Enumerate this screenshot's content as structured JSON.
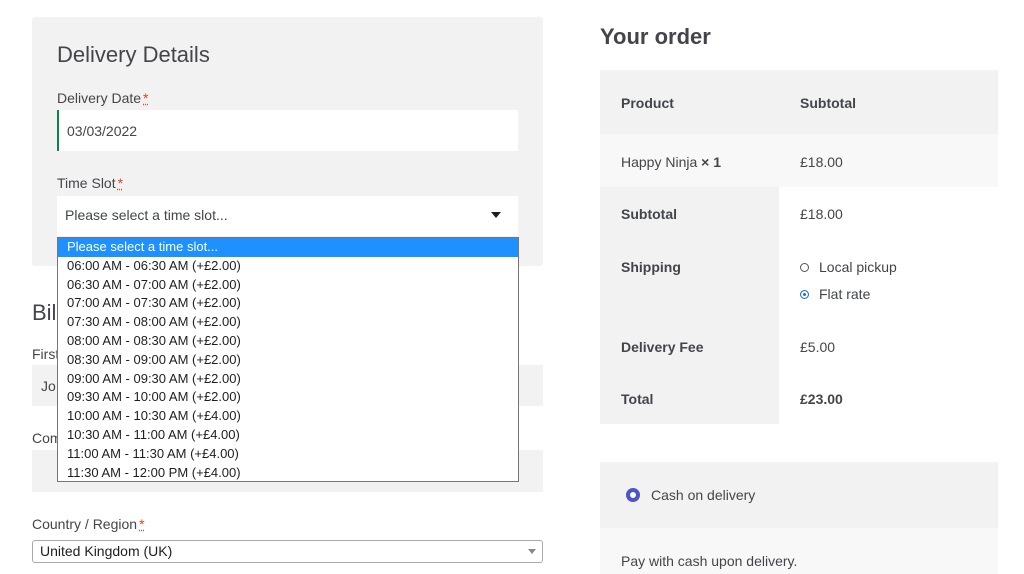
{
  "delivery": {
    "title": "Delivery Details",
    "date_label": "Delivery Date",
    "required_mark": "*",
    "date_value": "03/03/2022",
    "time_slot_label": "Time Slot",
    "time_slot_selected": "Please select a time slot...",
    "time_slot_options": [
      "Please select a time slot...",
      "06:00 AM - 06:30 AM (+£2.00)",
      "06:30 AM - 07:00 AM (+£2.00)",
      "07:00 AM - 07:30 AM (+£2.00)",
      "07:30 AM - 08:00 AM (+£2.00)",
      "08:00 AM - 08:30 AM (+£2.00)",
      "08:30 AM - 09:00 AM (+£2.00)",
      "09:00 AM - 09:30 AM (+£2.00)",
      "09:30 AM - 10:00 AM (+£2.00)",
      "10:00 AM - 10:30 AM (+£4.00)",
      "10:30 AM - 11:00 AM (+£4.00)",
      "11:00 AM - 11:30 AM (+£4.00)",
      "11:30 AM - 12:00 PM (+£4.00)"
    ]
  },
  "billing": {
    "title_partial": "Bil",
    "first_name_label_partial": "First",
    "first_name_value_partial": "Jo",
    "company_label_partial": "Com",
    "country_label": "Country / Region",
    "country_value": "United Kingdom (UK)"
  },
  "order": {
    "title": "Your order",
    "header_product": "Product",
    "header_subtotal": "Subtotal",
    "item_name": "Happy Ninja",
    "item_qty": "× 1",
    "item_price": "£18.00",
    "subtotal_label": "Subtotal",
    "subtotal_value": "£18.00",
    "shipping_label": "Shipping",
    "shipping_option_1": "Local pickup",
    "shipping_option_2": "Flat rate",
    "delivery_fee_label": "Delivery Fee",
    "delivery_fee_value": "£5.00",
    "total_label": "Total",
    "total_value": "£23.00"
  },
  "payment": {
    "method": "Cash on delivery",
    "description": "Pay with cash upon delivery."
  },
  "colors": {
    "accent_green": "#0f834d",
    "required_red": "#e2401c",
    "highlight_blue": "#1e90ff",
    "radio_blue": "#1e6fe0",
    "payment_radio": "#4d55c7"
  }
}
